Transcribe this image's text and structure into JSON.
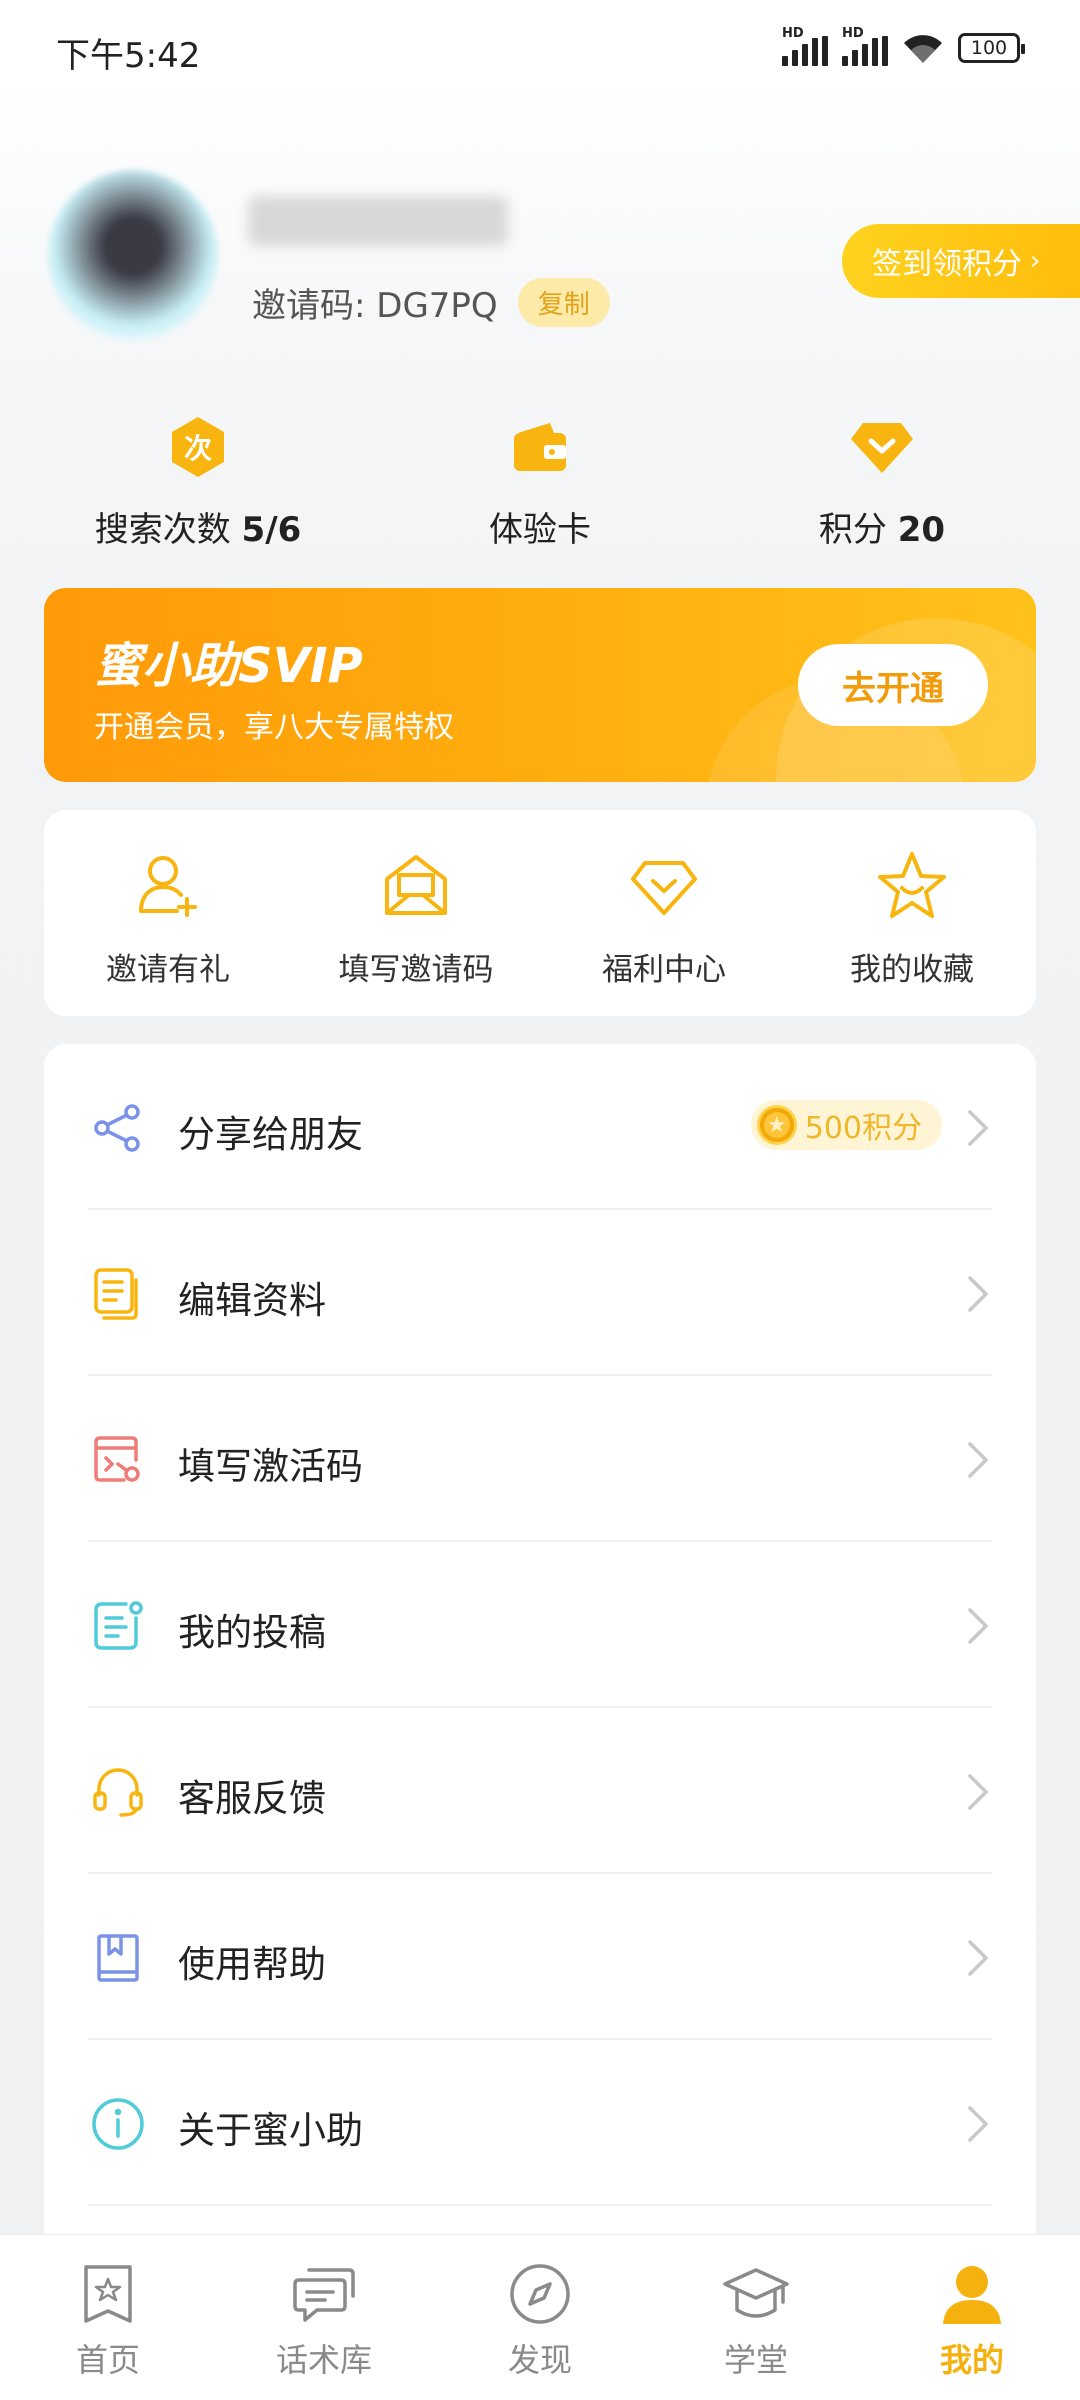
{
  "status_bar": {
    "time": "下午5:42",
    "battery": "100",
    "signal_label": "HD"
  },
  "profile": {
    "invite_code_label": "邀请码: DG7PQ",
    "copy_label": "复制",
    "signin_label": "签到领积分",
    "signin_arrow": "›"
  },
  "stats": [
    {
      "label": "搜索次数",
      "value": "5/6",
      "icon": "search-count-icon",
      "icon_char": "次"
    },
    {
      "label": "体验卡",
      "value": "",
      "icon": "wallet-icon"
    },
    {
      "label": "积分",
      "value": "20",
      "icon": "diamond-icon"
    }
  ],
  "vip": {
    "title": "蜜小助SVIP",
    "subtitle": "开通会员，享八大专属特权",
    "button": "去开通"
  },
  "quick_actions": [
    {
      "label": "邀请有礼",
      "icon": "add-user-icon"
    },
    {
      "label": "填写邀请码",
      "icon": "envelope-icon"
    },
    {
      "label": "福利中心",
      "icon": "diamond-icon"
    },
    {
      "label": "我的收藏",
      "icon": "star-icon"
    }
  ],
  "menu": [
    {
      "label": "分享给朋友",
      "icon": "share-icon",
      "badge": "500积分"
    },
    {
      "label": "编辑资料",
      "icon": "document-icon"
    },
    {
      "label": "填写激活码",
      "icon": "activation-code-icon"
    },
    {
      "label": "我的投稿",
      "icon": "submission-icon"
    },
    {
      "label": "客服反馈",
      "icon": "headset-icon"
    },
    {
      "label": "使用帮助",
      "icon": "book-icon"
    },
    {
      "label": "关于蜜小助",
      "icon": "info-icon"
    }
  ],
  "tabs": [
    {
      "label": "首页",
      "icon": "home-icon"
    },
    {
      "label": "话术库",
      "icon": "chat-icon"
    },
    {
      "label": "发现",
      "icon": "compass-icon"
    },
    {
      "label": "学堂",
      "icon": "graduation-cap-icon"
    },
    {
      "label": "我的",
      "icon": "user-icon",
      "active": true
    }
  ],
  "colors": {
    "accent": "#f5b10e",
    "vip_orange": "#ff9a09",
    "background": "#f1f3f4"
  }
}
